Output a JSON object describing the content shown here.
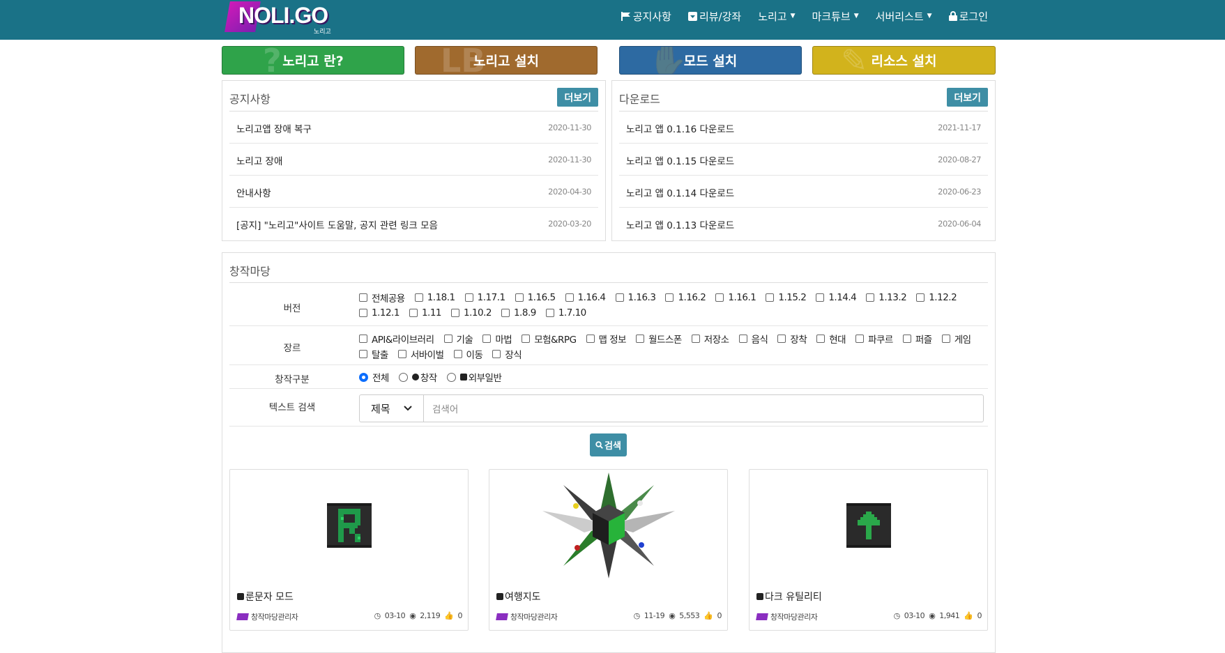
{
  "brand": {
    "logo_text": "NOLI.GO",
    "logo_sub": "노리고"
  },
  "nav": [
    {
      "label": "공지사항",
      "icon": "flag-icon",
      "caret": false
    },
    {
      "label": "리뷰/강좌",
      "icon": "caret-square-icon",
      "caret": false
    },
    {
      "label": "노리고",
      "icon": "",
      "caret": true
    },
    {
      "label": "마크튜브",
      "icon": "",
      "caret": true
    },
    {
      "label": "서버리스트",
      "icon": "",
      "caret": true
    },
    {
      "label": "로그인",
      "icon": "lock-icon",
      "caret": false
    }
  ],
  "big_buttons": [
    {
      "label": "노리고 란?",
      "color": "#2fa34a",
      "ghost": "?"
    },
    {
      "label": "노리고 설치",
      "color": "#a06a2e",
      "ghost": "LB"
    },
    {
      "label": "모드 설치",
      "color": "#2d6aa2",
      "ghost": "✋"
    },
    {
      "label": "리소스 설치",
      "color": "#d2b31c",
      "ghost": "✎"
    }
  ],
  "notice": {
    "title": "공지사항",
    "more": "더보기",
    "items": [
      {
        "title": "노리고앱 장애 복구",
        "date": "2020-11-30"
      },
      {
        "title": "노리고 장애",
        "date": "2020-11-30"
      },
      {
        "title": "안내사항",
        "date": "2020-04-30"
      },
      {
        "title": "[공지] \"노리고\"사이트 도움말, 공지 관련 링크 모음",
        "date": "2020-03-20"
      }
    ]
  },
  "downloads": {
    "title": "다운로드",
    "more": "더보기",
    "items": [
      {
        "title": "노리고 앱 0.1.16 다운로드",
        "date": "2021-11-17"
      },
      {
        "title": "노리고 앱 0.1.15 다운로드",
        "date": "2020-08-27"
      },
      {
        "title": "노리고 앱 0.1.14 다운로드",
        "date": "2020-06-23"
      },
      {
        "title": "노리고 앱 0.1.13 다운로드",
        "date": "2020-06-04"
      }
    ]
  },
  "creative": {
    "title": "창작마당",
    "version_label": "버전",
    "versions": [
      "전체공용",
      "1.18.1",
      "1.17.1",
      "1.16.5",
      "1.16.4",
      "1.16.3",
      "1.16.2",
      "1.16.1",
      "1.15.2",
      "1.14.4",
      "1.13.2",
      "1.12.2",
      "1.12.1",
      "1.11",
      "1.10.2",
      "1.8.9",
      "1.7.10"
    ],
    "genre_label": "장르",
    "genres": [
      "API&라이브러리",
      "기술",
      "마법",
      "모험&RPG",
      "맵 정보",
      "월드스폰",
      "저장소",
      "음식",
      "장착",
      "현대",
      "파쿠르",
      "퍼즐",
      "게임",
      "탈출",
      "서바이벌",
      "이동",
      "장식"
    ],
    "type_label": "창작구분",
    "types": [
      {
        "label": "전체",
        "checked": true,
        "icon": ""
      },
      {
        "label": "창작",
        "checked": false,
        "icon": "creation-icon"
      },
      {
        "label": "외부일반",
        "checked": false,
        "icon": "external-icon"
      }
    ],
    "search_label": "텍스트 검색",
    "search_select": "제목",
    "search_placeholder": "검색어",
    "search_button": "검색"
  },
  "cards": [
    {
      "title": "룬문자 모드",
      "author": "창작마당관리자",
      "date": "03-10",
      "views": "2,119",
      "likes": "0",
      "image": "rune"
    },
    {
      "title": "여행지도",
      "author": "창작마당관리자",
      "date": "11-19",
      "views": "5,553",
      "likes": "0",
      "image": "compass"
    },
    {
      "title": "다크 유틸리티",
      "author": "창작마당관리자",
      "date": "03-10",
      "views": "1,941",
      "likes": "0",
      "image": "dark"
    }
  ]
}
